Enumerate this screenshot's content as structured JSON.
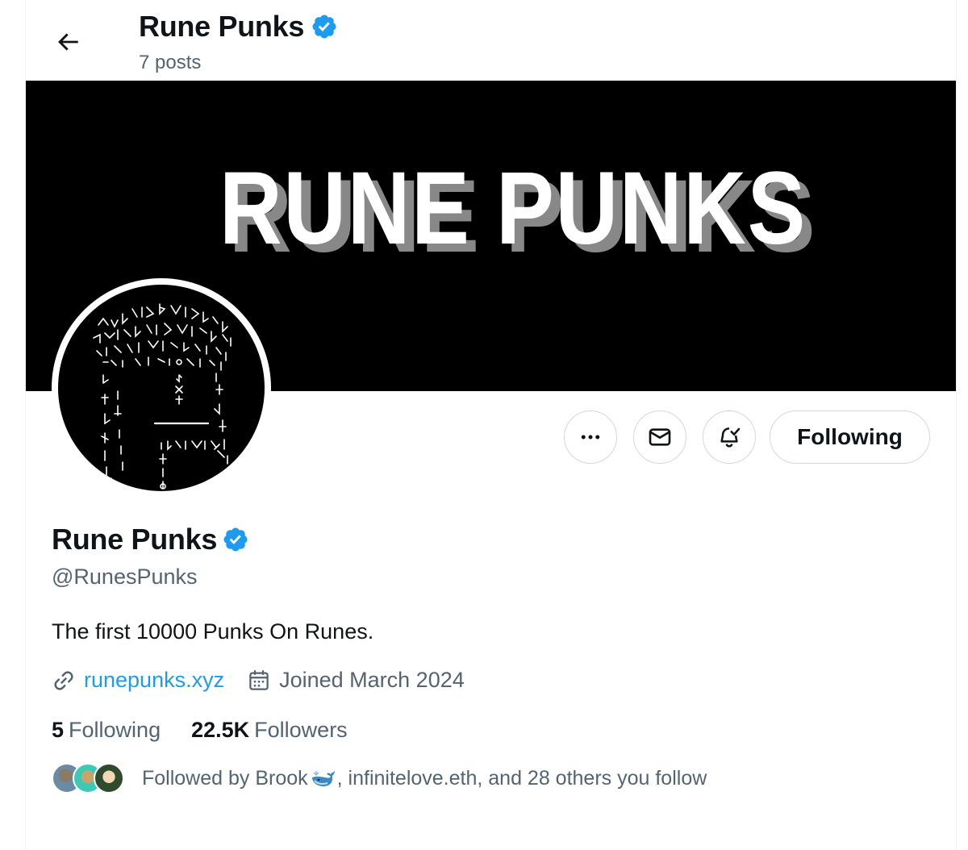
{
  "header": {
    "title": "Rune Punks",
    "posts": "7 posts"
  },
  "banner": {
    "text": "RUNE PUNKS"
  },
  "actions": {
    "follow_label": "Following"
  },
  "profile": {
    "name": "Rune Punks",
    "handle": "@RunesPunks",
    "bio": "The first 10000 Punks On Runes.",
    "website": "runepunks.xyz",
    "joined": "Joined March 2024",
    "following_count": "5",
    "following_label": "Following",
    "followers_count": "22.5K",
    "followers_label": "Followers",
    "followed_by_pre": "Followed by Brook ",
    "followed_by_post": ", infinitelove.eth, and 28 others you follow"
  },
  "colors": {
    "accent": "#1d9bf0",
    "verified": "#1d9bf0",
    "secondary_text": "#536471",
    "border": "#cfd9de"
  },
  "icons": [
    "back-arrow-icon",
    "verified-badge-icon",
    "more-icon",
    "mail-icon",
    "bell-plus-icon",
    "link-icon",
    "calendar-icon",
    "whale-emoji-icon"
  ]
}
